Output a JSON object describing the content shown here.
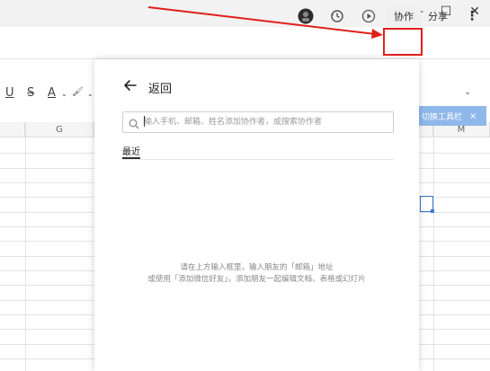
{
  "window": {
    "minimize_glyph": "—",
    "maximize_glyph": "☐",
    "close_glyph": "✕"
  },
  "header": {
    "icons": [
      "avatar",
      "history-icon",
      "play-icon"
    ],
    "collab_label": "协作",
    "share_label": "分享",
    "more_glyph": "⋮"
  },
  "format_toolbar": {
    "underline": "U",
    "strikethrough": "S",
    "font_color": "A",
    "fill_glyph": "🖌",
    "dropdown_glyph": "⌄",
    "side_dropdown_glyph": "⌄"
  },
  "grid": {
    "columns": [
      "G",
      "M"
    ]
  },
  "tooltip": {
    "text": "切换工具栏",
    "close_glyph": "×"
  },
  "panel": {
    "title": "返回",
    "search_placeholder": "输入手机、邮箱、姓名添加协作者，或搜索协作者",
    "tab_recent": "最近",
    "empty_line1": "请在上方输入框里，输入朋友的「邮箱」地址",
    "empty_line2": "或使用「添加微信好友」，添加朋友一起编辑文档、表格或幻灯片"
  },
  "colors": {
    "annotation_red": "#e0201b",
    "accent_blue": "#3a7bd5"
  }
}
